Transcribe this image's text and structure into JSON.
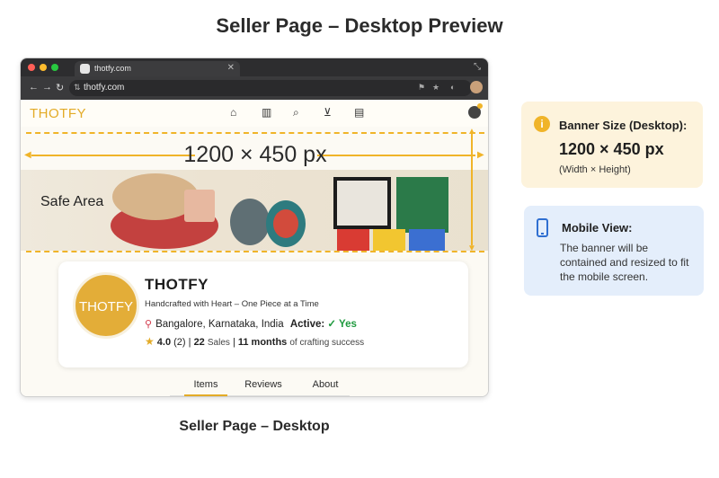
{
  "page": {
    "title": "Seller Page – Desktop Preview",
    "caption": "Seller Page – Desktop"
  },
  "browser": {
    "tab_title": "thotfy.com",
    "url": "thotfy.com"
  },
  "site": {
    "brand": "THOTFY",
    "nav_icons": [
      "home-icon",
      "book-icon",
      "search-icon",
      "cart-icon",
      "orders-icon"
    ],
    "banner": {
      "safe_area_label": "Safe Area",
      "dimensions": "1200 × 450 px"
    },
    "profile": {
      "avatar_text": "THOTFY",
      "name": "THOTFY",
      "tagline": "Handcrafted with Heart – One Piece at a Time",
      "location": "Bangalore, Karnataka, India",
      "active_label": "Active:",
      "active_value": "✓ Yes",
      "rating": "4.0",
      "reviews_count": "(2)",
      "sales_count": "22",
      "sales_label": "Sales",
      "months": "11 months",
      "months_suffix": "of crafting success",
      "separator": "|"
    },
    "tabs": [
      {
        "label": "Items",
        "active": true
      },
      {
        "label": "Reviews",
        "active": false
      },
      {
        "label": "About",
        "active": false
      }
    ]
  },
  "info_desktop": {
    "title": "Banner Size (Desktop):",
    "size": "1200 × 450 px",
    "note": "(Width × Height)"
  },
  "info_mobile": {
    "title": "Mobile View:",
    "body": "The banner will be contained and resized to fit the mobile screen."
  },
  "colors": {
    "accent": "#f0b429",
    "brand": "#e3ab27",
    "active_green": "#1f9a3f",
    "mobile_blue": "#2f6fd1"
  }
}
